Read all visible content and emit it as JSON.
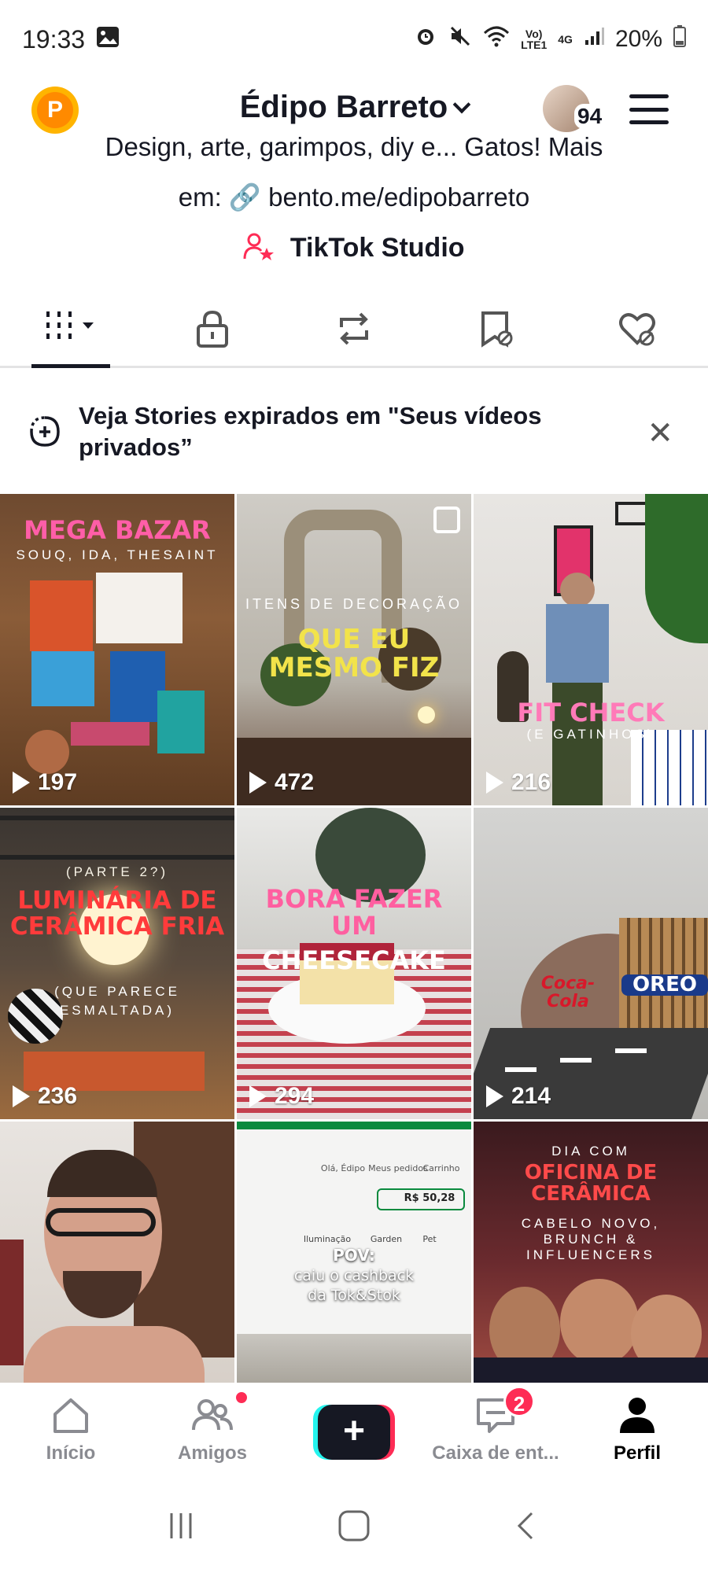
{
  "status_bar": {
    "time": "19:33",
    "carrier_top": "Vo)",
    "carrier_bottom": "LTE1",
    "network": "4G",
    "battery": "20%"
  },
  "header": {
    "coin_letter": "P",
    "profile_name": "Édipo Barreto",
    "followers_avatar_count": "94"
  },
  "bio": {
    "line1": "Design, arte, garimpos, diy e... Gatos! Mais",
    "line2": "em: 🔗 bento.me/edipobarreto",
    "studio_label": "TikTok Studio"
  },
  "tabs": [
    "videos",
    "private",
    "reposts",
    "favorites",
    "liked"
  ],
  "banner": {
    "text": "Veja Stories expirados em \"Seus vídeos privados”"
  },
  "videos": [
    {
      "caption": "MEGA BAZAR",
      "subcaption": "SOUQ, IDA, THESAINT",
      "views": "197"
    },
    {
      "caption": "QUE EU MESMO FIZ",
      "subcaption": "ITENS DE DECORAÇÃO",
      "views": "472"
    },
    {
      "caption": "FIT CHECK",
      "subcaption": "(E GATINHOS)",
      "views": "216"
    },
    {
      "caption": "LUMINÁRIA DE CERÂMICA FRIA",
      "subcaption": "(PARTE 2?)",
      "subcaption2": "(QUE PARECE ESMALTADA)",
      "views": "236"
    },
    {
      "caption": "BORA FAZER UM",
      "caption2": "CHEESECAKE",
      "views": "294"
    },
    {
      "caption": "OREO",
      "caption2": "Coca-Cola",
      "views": "214"
    },
    {
      "caption": ""
    },
    {
      "caption": "POV:",
      "caption2": "caiu o cashback",
      "caption3": "da Tok&Stok",
      "ui_text1": "Olá, Édipo",
      "ui_text2": "Meus pedidos",
      "ui_text3": "Carrinho",
      "ui_text4": "R$ 50,28",
      "ui_text5": "Iluminação",
      "ui_text6": "Garden",
      "ui_text7": "Pet"
    },
    {
      "caption": "OFICINA DE CERÂMICA",
      "subcaption": "DIA COM",
      "subcaption2": "CABELO NOVO, BRUNCH & INFLUENCERS"
    }
  ],
  "bottom_nav": {
    "home": "Início",
    "friends": "Amigos",
    "inbox": "Caixa de ent...",
    "inbox_badge": "2",
    "profile": "Perfil"
  },
  "colors": {
    "accent": "#fe2c55",
    "cyan": "#25f4ee",
    "text": "#161823"
  }
}
